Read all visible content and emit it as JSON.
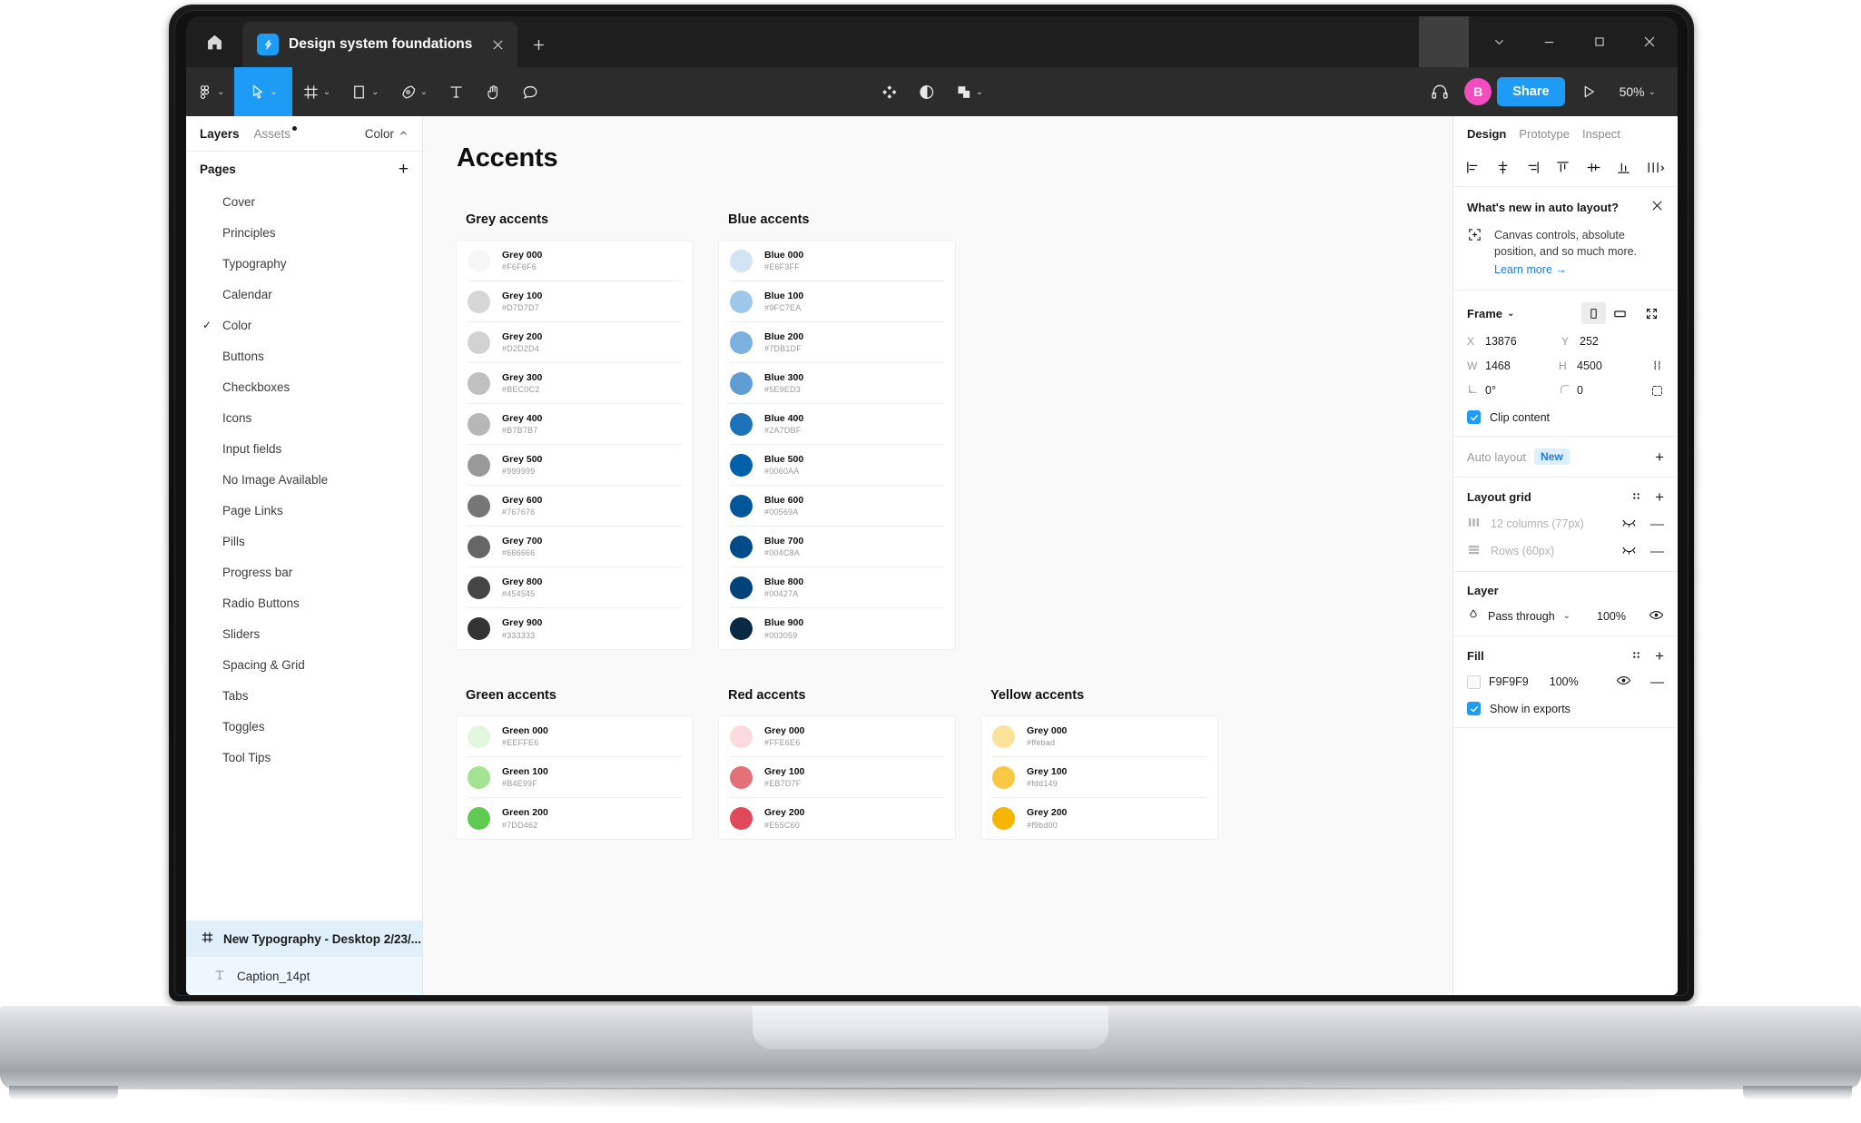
{
  "window": {
    "home_icon": "home-icon",
    "tab": {
      "title": "Design system foundations",
      "file_icon": "figma-file-icon",
      "close_icon": "close-icon"
    },
    "new_tab_icon": "plus-icon",
    "controls": {
      "chevron": "chevron-down-icon",
      "minimize": "minimize-icon",
      "maximize": "maximize-icon",
      "close": "close-icon"
    }
  },
  "toolbar": {
    "menu_icon": "figma-logo-icon",
    "tools": [
      {
        "name": "move-tool",
        "icon": "cursor-icon",
        "active": true
      },
      {
        "name": "frame-tool",
        "icon": "frame-icon",
        "active": false
      },
      {
        "name": "shape-tool",
        "icon": "rectangle-icon",
        "active": false
      },
      {
        "name": "pen-tool",
        "icon": "pen-icon",
        "active": false
      },
      {
        "name": "text-tool",
        "icon": "text-icon",
        "active": false
      },
      {
        "name": "hand-tool",
        "icon": "hand-icon",
        "active": false
      },
      {
        "name": "comment-tool",
        "icon": "comment-icon",
        "active": false
      }
    ],
    "center_icons": [
      "components-icon",
      "contrast-icon",
      "mask-icon"
    ],
    "headphones_icon": "headphones-icon",
    "avatar_initial": "B",
    "avatar_color": "#f24dbd",
    "share_label": "Share",
    "present_icon": "play-icon",
    "zoom_level": "50%",
    "accent_color": "#1e9cf5"
  },
  "left_panel": {
    "tabs": [
      {
        "label": "Layers",
        "active": true
      },
      {
        "label": "Assets",
        "active": false,
        "has_dot": true
      }
    ],
    "color_label": "Color",
    "pages_header": "Pages",
    "add_page_icon": "plus-icon",
    "pages": [
      {
        "label": "Cover",
        "selected": false
      },
      {
        "label": "Principles",
        "selected": false
      },
      {
        "label": "Typography",
        "selected": false
      },
      {
        "label": "Calendar",
        "selected": false
      },
      {
        "label": "Color",
        "selected": true
      },
      {
        "label": "Buttons",
        "selected": false
      },
      {
        "label": "Checkboxes",
        "selected": false
      },
      {
        "label": "Icons",
        "selected": false
      },
      {
        "label": "Input fields",
        "selected": false
      },
      {
        "label": "No Image Available",
        "selected": false
      },
      {
        "label": "Page Links",
        "selected": false
      },
      {
        "label": "Pills",
        "selected": false
      },
      {
        "label": "Progress bar",
        "selected": false
      },
      {
        "label": "Radio Buttons",
        "selected": false
      },
      {
        "label": "Sliders",
        "selected": false
      },
      {
        "label": "Spacing & Grid",
        "selected": false
      },
      {
        "label": "Tabs",
        "selected": false
      },
      {
        "label": "Toggles",
        "selected": false
      },
      {
        "label": "Tool Tips",
        "selected": false
      }
    ],
    "selected_layer": {
      "icon": "frame-icon",
      "label": "New Typography - Desktop 2/23/..."
    },
    "child_layer": {
      "icon": "text-icon",
      "label": "Caption_14pt"
    }
  },
  "canvas": {
    "title": "Accents",
    "sections": [
      {
        "heading": "Grey accents",
        "swatches": [
          {
            "name": "Grey 000",
            "hex": "#F6F6F6",
            "color": "#F6F6F6"
          },
          {
            "name": "Grey 100",
            "hex": "#D7D7D7",
            "color": "#D7D7D7"
          },
          {
            "name": "Grey 200",
            "hex": "#D2D2D4",
            "color": "#D2D2D4"
          },
          {
            "name": "Grey 300",
            "hex": "#BEC0C2",
            "color": "#BEC0C2"
          },
          {
            "name": "Grey 400",
            "hex": "#B7B7B7",
            "color": "#B7B7B7"
          },
          {
            "name": "Grey 500",
            "hex": "#999999",
            "color": "#999999"
          },
          {
            "name": "Grey 600",
            "hex": "#767676",
            "color": "#767676"
          },
          {
            "name": "Grey 700",
            "hex": "#666666",
            "color": "#666666"
          },
          {
            "name": "Grey 800",
            "hex": "#454545",
            "color": "#454545"
          },
          {
            "name": "Grey 900",
            "hex": "#333333",
            "color": "#333333"
          }
        ]
      },
      {
        "heading": "Blue accents",
        "swatches": [
          {
            "name": "Blue 000",
            "hex": "#E6F3FF",
            "color": "#D3E4F5"
          },
          {
            "name": "Blue 100",
            "hex": "#9FC7EA",
            "color": "#9FC7EA"
          },
          {
            "name": "Blue 200",
            "hex": "#7DB1DF",
            "color": "#7DB1DF"
          },
          {
            "name": "Blue 300",
            "hex": "#5E9ED3",
            "color": "#5E9ED3"
          },
          {
            "name": "Blue 400",
            "hex": "#2A7DBF",
            "color": "#1E72B8"
          },
          {
            "name": "Blue 500",
            "hex": "#0060AA",
            "color": "#0060AA"
          },
          {
            "name": "Blue 600",
            "hex": "#00569A",
            "color": "#00569A"
          },
          {
            "name": "Blue 700",
            "hex": "#004C8A",
            "color": "#004C8A"
          },
          {
            "name": "Blue 800",
            "hex": "#00427A",
            "color": "#00427A"
          },
          {
            "name": "Blue 900",
            "hex": "#003059",
            "color": "#0A2A44"
          }
        ]
      }
    ],
    "sections_row2": [
      {
        "heading": "Green accents",
        "swatches": [
          {
            "name": "Green 000",
            "hex": "#EEFFE6",
            "color": "#E2F8DC"
          },
          {
            "name": "Green 100",
            "hex": "#B4E99F",
            "color": "#A4E392"
          },
          {
            "name": "Green 200",
            "hex": "#7DD462",
            "color": "#5FC952"
          }
        ]
      },
      {
        "heading": "Red accents",
        "swatches": [
          {
            "name": "Grey 000",
            "hex": "#FFE6E6",
            "color": "#FBDBDE"
          },
          {
            "name": "Grey 100",
            "hex": "#EB7D7F",
            "color": "#E4717A"
          },
          {
            "name": "Grey 200",
            "hex": "#E55C60",
            "color": "#E0495A"
          }
        ]
      },
      {
        "heading": "Yellow accents",
        "swatches": [
          {
            "name": "Grey 000",
            "hex": "#ffebad",
            "color": "#FCE29B"
          },
          {
            "name": "Grey 100",
            "hex": "#fdd149",
            "color": "#F9C945"
          },
          {
            "name": "Grey 200",
            "hex": "#f9bd00",
            "color": "#F5B500"
          }
        ]
      }
    ]
  },
  "right_panel": {
    "tabs": [
      {
        "label": "Design",
        "active": true
      },
      {
        "label": "Prototype",
        "active": false
      },
      {
        "label": "Inspect",
        "active": false
      }
    ],
    "align_icons": [
      "align-left-icon",
      "align-horizontal-center-icon",
      "align-right-icon",
      "align-top-icon",
      "align-vertical-center-icon",
      "align-bottom-icon",
      "distribute-icon"
    ],
    "promo": {
      "title": "What's new in auto layout?",
      "close_icon": "close-icon",
      "badge_icon": "auto-layout-icon",
      "text": "Canvas controls, absolute position, and so much more.",
      "link": "Learn more →"
    },
    "frame": {
      "label": "Frame",
      "portrait_icon": "portrait-orientation-icon",
      "landscape_icon": "landscape-orientation-icon",
      "resize_icon": "resize-to-fit-icon",
      "x_label": "X",
      "x_value": "13876",
      "y_label": "Y",
      "y_value": "252",
      "w_label": "W",
      "w_value": "1468",
      "h_label": "H",
      "h_value": "4500",
      "rotation_label": "rotation-icon",
      "rotation_value": "0°",
      "corner_label": "corner-radius-icon",
      "corner_value": "0",
      "constrain_icon": "constrain-proportions-icon",
      "independent_corners_icon": "independent-corners-icon",
      "clip_content_label": "Clip content",
      "clip_content_checked": true
    },
    "auto_layout": {
      "label": "Auto layout",
      "badge": "New",
      "add_icon": "plus-icon"
    },
    "layout_grid": {
      "label": "Layout grid",
      "settings_icon": "style-icon",
      "add_icon": "plus-icon",
      "rows": [
        {
          "icon": "columns-icon",
          "label": "12 columns (77px)",
          "visible": false
        },
        {
          "icon": "rows-icon",
          "label": "Rows (60px)",
          "visible": false
        }
      ]
    },
    "layer": {
      "label": "Layer",
      "blend_icon": "blend-mode-icon",
      "blend_mode": "Pass through",
      "opacity": "100%",
      "visibility_icon": "eye-icon"
    },
    "fill": {
      "label": "Fill",
      "settings_icon": "style-icon",
      "add_icon": "plus-icon",
      "hex": "F9F9F9",
      "opacity": "100%",
      "visibility_icon": "eye-icon",
      "remove_icon": "minus-icon",
      "show_in_exports_label": "Show in exports",
      "show_in_exports_checked": true
    }
  }
}
